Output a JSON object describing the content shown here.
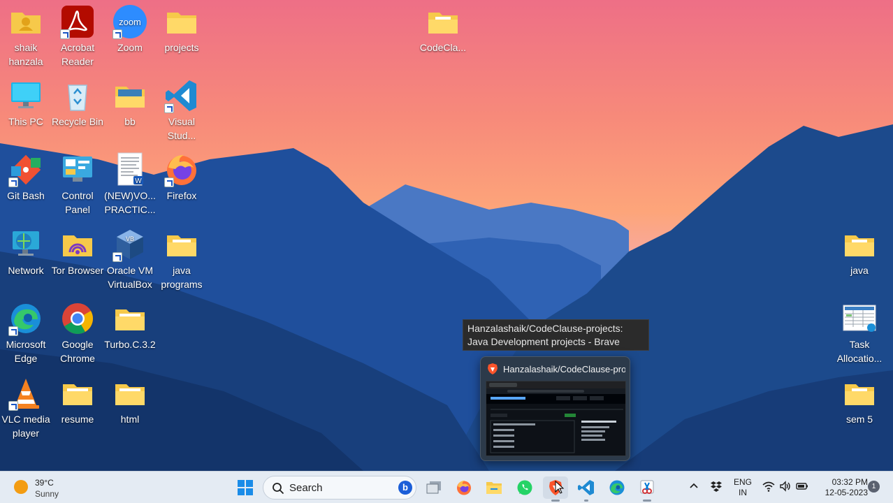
{
  "desktop": {
    "icons": [
      {
        "label": "shaik hanzala",
        "icon": "user-folder-icon"
      },
      {
        "label": "Acrobat Reader",
        "icon": "acrobat-icon"
      },
      {
        "label": "Zoom",
        "icon": "zoom-icon"
      },
      {
        "label": "projects",
        "icon": "folder-icon"
      },
      {
        "label": "CodeCla...",
        "icon": "folder-icon"
      },
      {
        "label": "This PC",
        "icon": "monitor-icon"
      },
      {
        "label": "Recycle Bin",
        "icon": "recycle-bin-icon"
      },
      {
        "label": "bb",
        "icon": "folder-icon"
      },
      {
        "label": "Visual Stud...",
        "icon": "vscode-icon"
      },
      {
        "label": "Git Bash",
        "icon": "git-icon"
      },
      {
        "label": "Control Panel",
        "icon": "control-panel-icon"
      },
      {
        "label": "(NEW)VO... PRACTIC...",
        "icon": "word-document-icon"
      },
      {
        "label": "Firefox",
        "icon": "firefox-icon"
      },
      {
        "label": "Network",
        "icon": "network-icon"
      },
      {
        "label": "Tor Browser",
        "icon": "tor-folder-icon"
      },
      {
        "label": "Oracle VM VirtualBox",
        "icon": "virtualbox-icon"
      },
      {
        "label": "java programs",
        "icon": "folder-icon"
      },
      {
        "label": "java",
        "icon": "folder-icon"
      },
      {
        "label": "Microsoft Edge",
        "icon": "edge-icon"
      },
      {
        "label": "Google Chrome",
        "icon": "chrome-icon"
      },
      {
        "label": "Turbo.C.3.2",
        "icon": "folder-icon"
      },
      {
        "label": "Task Allocatio...",
        "icon": "spreadsheet-icon"
      },
      {
        "label": "VLC media player",
        "icon": "vlc-icon"
      },
      {
        "label": "resume",
        "icon": "folder-icon"
      },
      {
        "label": "html",
        "icon": "folder-icon"
      },
      {
        "label": "sem 5",
        "icon": "folder-icon"
      }
    ]
  },
  "tooltip": {
    "text": "Hanzalashaik/CodeClause-projects: Java Development projects - Brave"
  },
  "preview": {
    "title": "Hanzalashaik/CodeClause-proj...",
    "icon": "brave-icon"
  },
  "taskbar": {
    "weather": {
      "temp": "39°C",
      "condition": "Sunny"
    },
    "search": {
      "label": "Search"
    },
    "apps": [
      {
        "name": "start-button",
        "icon": "windows-logo-icon"
      },
      {
        "name": "task-view-button",
        "icon": "task-view-icon"
      },
      {
        "name": "firefox-button",
        "icon": "firefox-icon"
      },
      {
        "name": "file-explorer-button",
        "icon": "folder-icon"
      },
      {
        "name": "whatsapp-button",
        "icon": "whatsapp-icon"
      },
      {
        "name": "brave-button",
        "icon": "brave-icon"
      },
      {
        "name": "vscode-button",
        "icon": "vscode-icon"
      },
      {
        "name": "edge-button",
        "icon": "edge-icon"
      },
      {
        "name": "snipping-tool-button",
        "icon": "snipping-tool-icon"
      }
    ],
    "tray": {
      "lang_line1": "ENG",
      "lang_line2": "IN",
      "time": "03:32 PM",
      "date": "12-05-2023",
      "notifications": "1"
    }
  },
  "colors": {
    "folder": "#f6c94a",
    "taskbar": "#e4ebf3",
    "sky_top": "#f07a8c",
    "mountain": "#1c4a8c"
  }
}
